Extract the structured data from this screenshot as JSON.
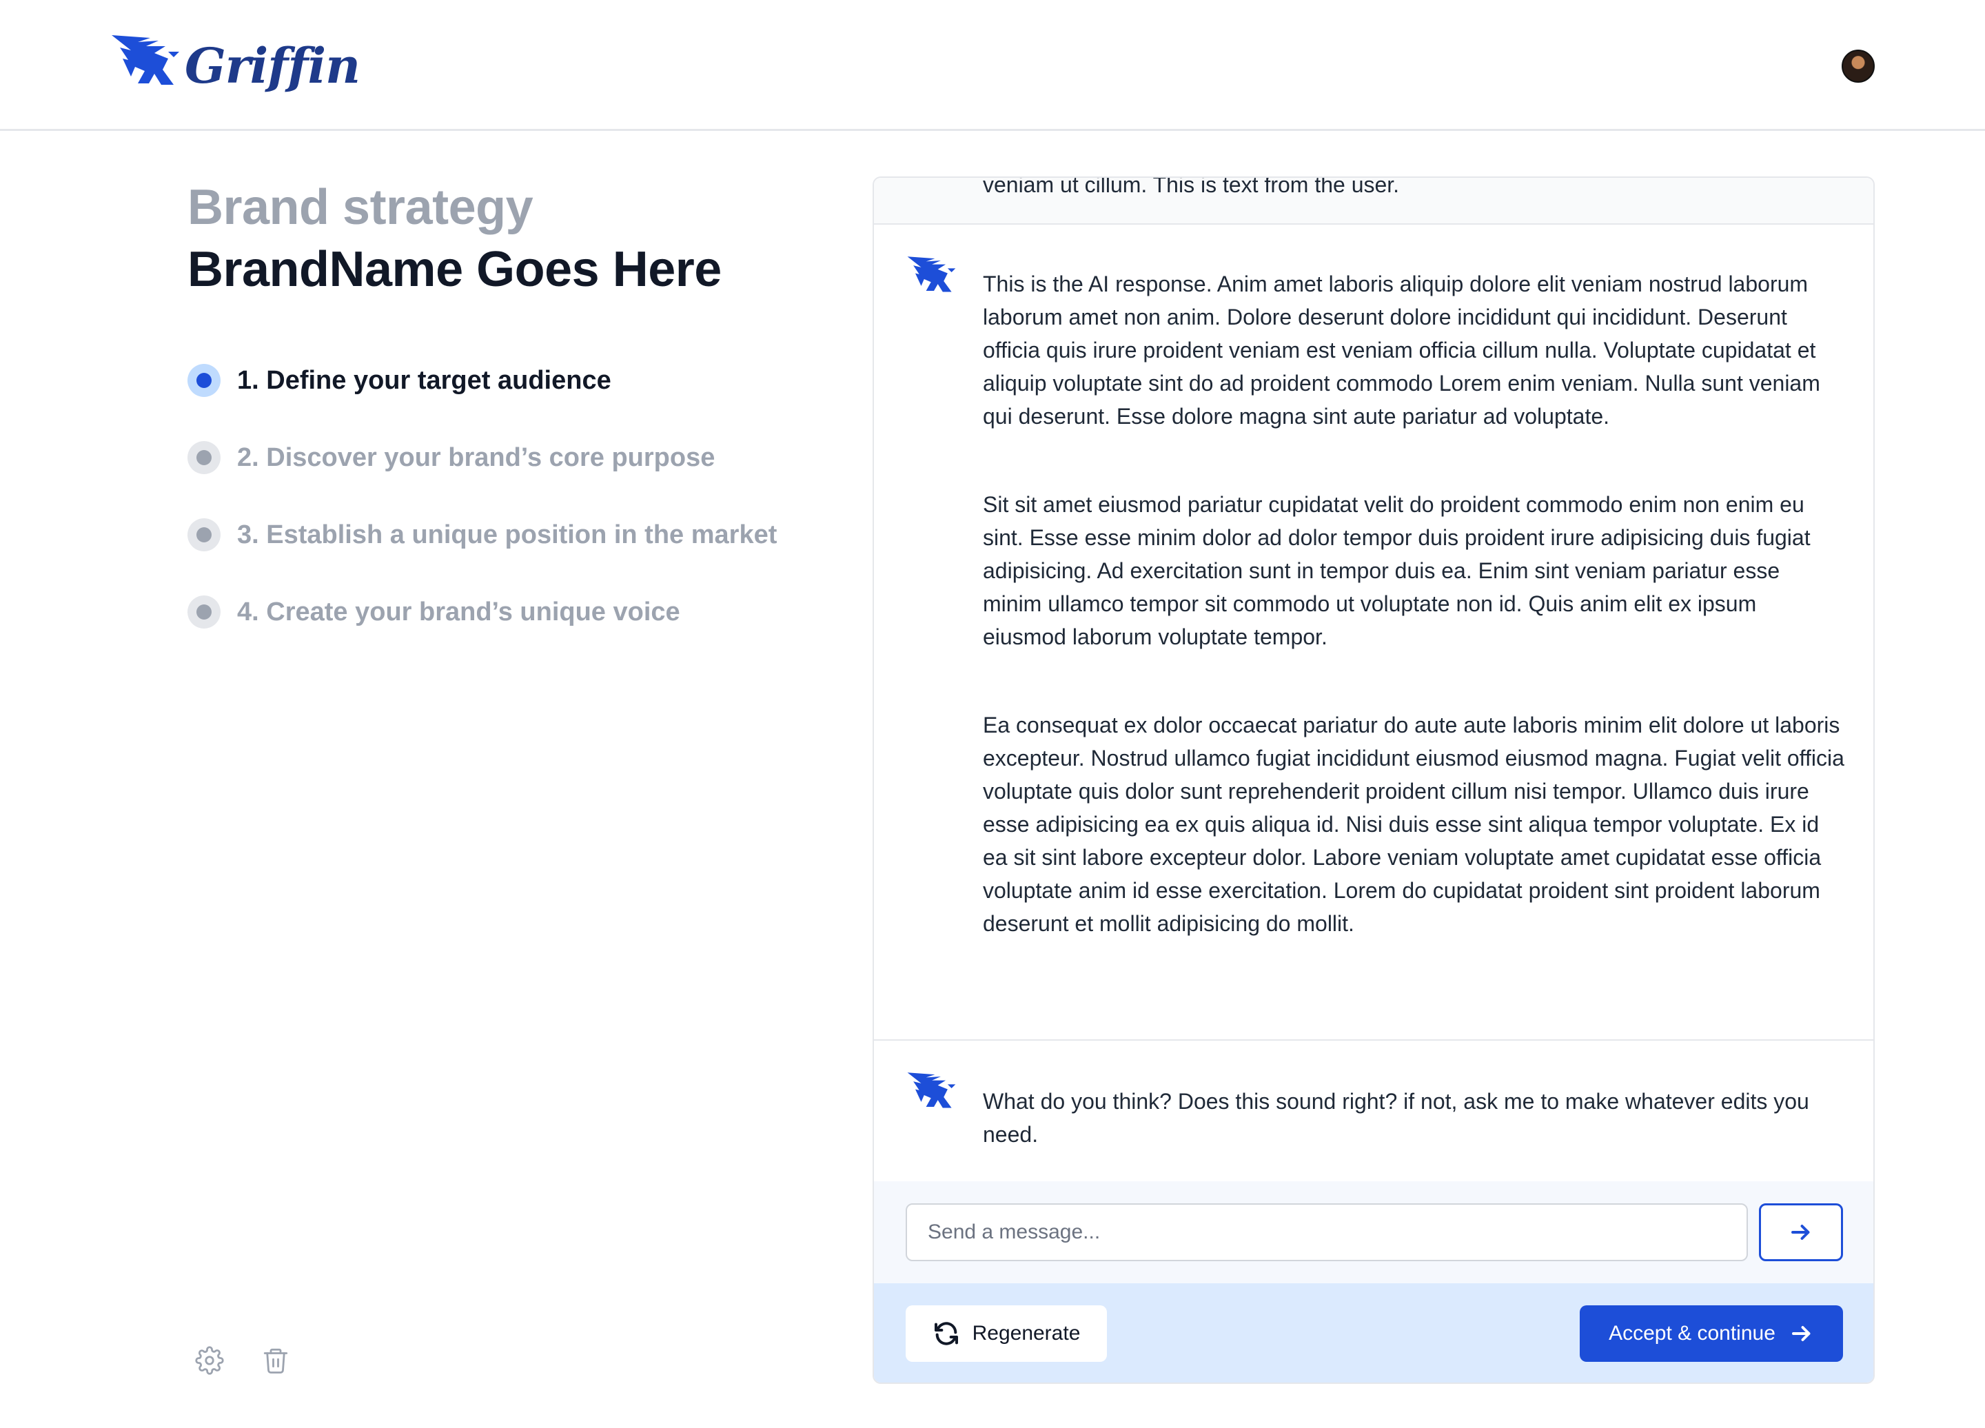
{
  "header": {
    "logo_text": "Griffin",
    "logo_icon": "griffin-logo-icon",
    "avatar_icon": "user-avatar"
  },
  "strategy": {
    "subtitle": "Brand strategy",
    "brand_name": "BrandName Goes Here",
    "steps": [
      {
        "label": "1. Define your target audience",
        "active": true
      },
      {
        "label": "2. Discover your brand’s core purpose",
        "active": false
      },
      {
        "label": "3. Establish a unique position in the market",
        "active": false
      },
      {
        "label": "4. Create your brand’s unique voice",
        "active": false
      }
    ],
    "footer_icons": [
      "gear-icon",
      "trash-icon"
    ]
  },
  "chat": {
    "user_message": "veniam ut cillum. This is text from the user.",
    "ai_response": [
      "This is the AI response. Anim amet laboris aliquip dolore elit veniam nostrud laborum laborum amet non anim. Dolore deserunt dolore incididunt qui incididunt. Deserunt officia quis irure proident veniam est veniam officia cillum nulla. Voluptate cupidatat et aliquip voluptate sint do ad proident commodo Lorem enim veniam. Nulla sunt veniam qui deserunt. Esse dolore magna sint aute pariatur ad voluptate.",
      "Sit sit amet eiusmod pariatur cupidatat velit do proident commodo enim non enim eu sint. Esse esse minim dolor ad dolor tempor duis proident irure adipisicing duis fugiat adipisicing. Ad exercitation sunt in tempor duis ea. Enim sint veniam pariatur esse minim ullamco tempor sit commodo ut voluptate non id. Quis anim elit ex ipsum eiusmod laborum voluptate tempor.",
      "Ea consequat ex dolor occaecat pariatur do aute aute laboris minim elit dolore ut laboris excepteur. Nostrud ullamco fugiat incididunt eiusmod eiusmod magna. Fugiat velit officia voluptate quis dolor sunt reprehenderit proident cillum nisi tempor. Ullamco duis irure esse adipisicing ea ex quis aliqua id. Nisi duis esse sint aliqua tempor voluptate. Ex id ea sit sint labore excepteur dolor. Labore veniam voluptate amet cupidatat esse officia voluptate anim id esse exercitation. Lorem do cupidatat proident sint proident laborum deserunt et mollit adipisicing do mollit."
    ],
    "ai_followup": "What do you think? Does this sound right? if not, ask me to make whatever edits you need.",
    "input_placeholder": "Send a message...",
    "input_value": "",
    "send_icon": "arrow-right-icon",
    "regenerate_label": "Regenerate",
    "regenerate_icon": "refresh-icon",
    "accept_label": "Accept & continue",
    "accept_icon": "arrow-right-icon"
  },
  "colors": {
    "brand_blue": "#1d4ed8",
    "logo_navy": "#1e3a8a",
    "muted_gray": "#9ca3af",
    "action_bar_bg": "#dbeafe"
  }
}
